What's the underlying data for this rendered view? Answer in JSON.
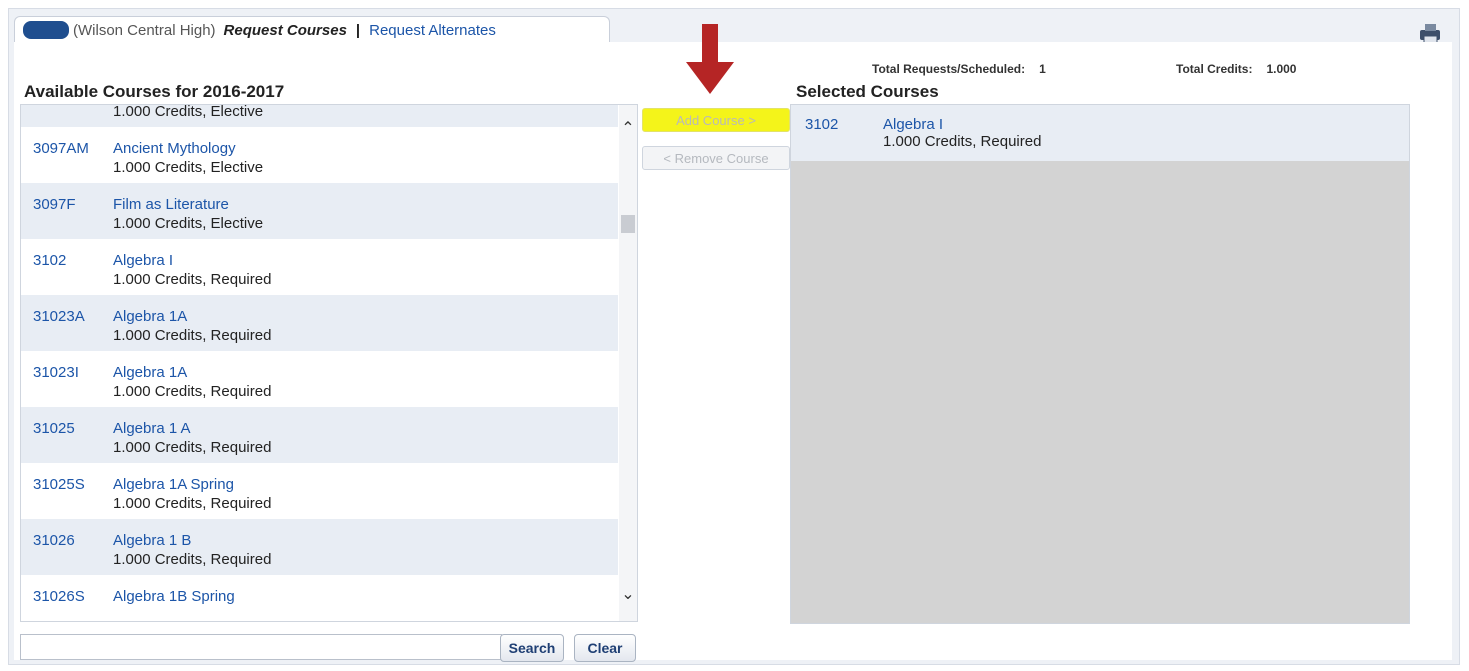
{
  "tabs": {
    "school": "(Wilson Central High)",
    "active": "Request Courses",
    "separator": "|",
    "alternates": "Request Alternates"
  },
  "totals": {
    "requests_label": "Total Requests/Scheduled:",
    "requests_value": "1",
    "credits_label": "Total Credits:",
    "credits_value": "1.000"
  },
  "available": {
    "title": "Available Courses for 2016-2017",
    "courses": [
      {
        "code": "",
        "name": "",
        "meta": "1.000 Credits,  Elective"
      },
      {
        "code": "3097AM",
        "name": "Ancient Mythology",
        "meta": "1.000 Credits,  Elective"
      },
      {
        "code": "3097F",
        "name": "Film as Literature",
        "meta": "1.000 Credits,  Elective"
      },
      {
        "code": "3102",
        "name": "Algebra I",
        "meta": "1.000 Credits,  Required"
      },
      {
        "code": "31023A",
        "name": "Algebra 1A",
        "meta": "1.000 Credits,  Required"
      },
      {
        "code": "31023I",
        "name": "Algebra 1A",
        "meta": "1.000 Credits,  Required"
      },
      {
        "code": "31025",
        "name": "Algebra 1 A",
        "meta": "1.000 Credits,  Required"
      },
      {
        "code": "31025S",
        "name": "Algebra 1A Spring",
        "meta": "1.000 Credits,  Required"
      },
      {
        "code": "31026",
        "name": "Algebra 1 B",
        "meta": "1.000 Credits,  Required"
      },
      {
        "code": "31026S",
        "name": "Algebra 1B Spring",
        "meta": ""
      }
    ]
  },
  "actions": {
    "add": "Add Course >",
    "remove": "< Remove Course"
  },
  "selected": {
    "title": "Selected Courses",
    "courses": [
      {
        "code": "3102",
        "name": "Algebra I",
        "meta": "1.000 Credits,  Required"
      }
    ]
  },
  "search": {
    "value": "",
    "placeholder": "",
    "search_label": "Search",
    "clear_label": "Clear"
  },
  "colors": {
    "highlight": "#f4f41a",
    "link": "#1c55a8",
    "arrow": "#b52525"
  }
}
